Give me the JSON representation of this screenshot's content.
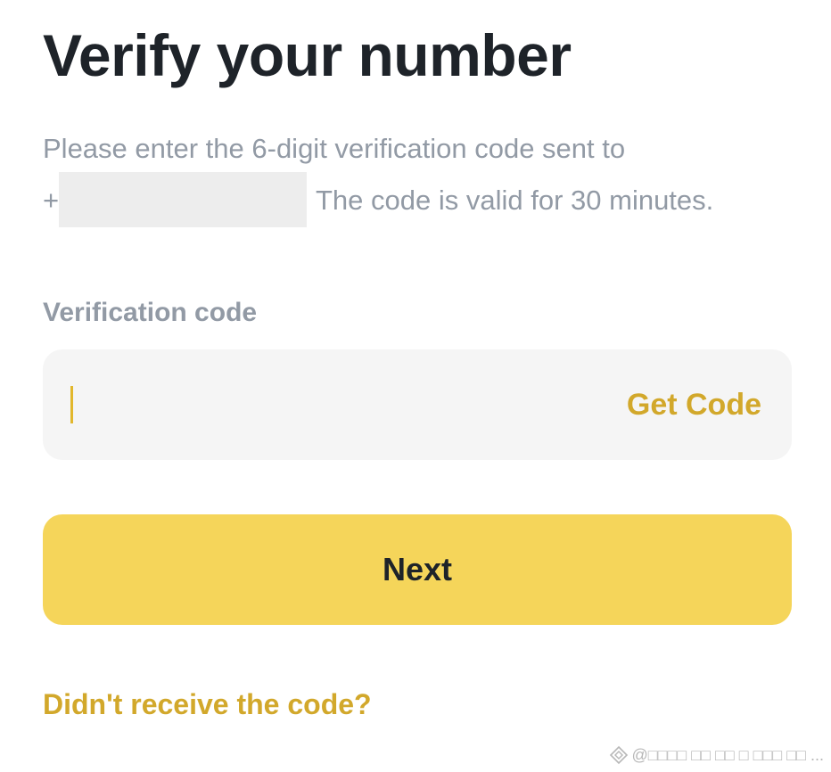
{
  "title": "Verify your number",
  "description": {
    "line1": "Please enter the 6-digit verification code sent to",
    "phone_prefix": "+",
    "line2_suffix": "The code is valid for 30 minutes."
  },
  "verification": {
    "label": "Verification code",
    "input_value": "",
    "get_code_label": "Get Code"
  },
  "next_label": "Next",
  "resend_label": "Didn't receive the code?",
  "watermark": {
    "text": "@□□□□ □□ □□ □ □□□ □□ ..."
  },
  "colors": {
    "title": "#1e2329",
    "muted_text": "#929aa5",
    "accent": "#d2a82b",
    "button_bg": "#f5d55a",
    "field_bg": "#f5f5f5"
  },
  "icons": {
    "watermark": "diamond-logo-icon"
  }
}
